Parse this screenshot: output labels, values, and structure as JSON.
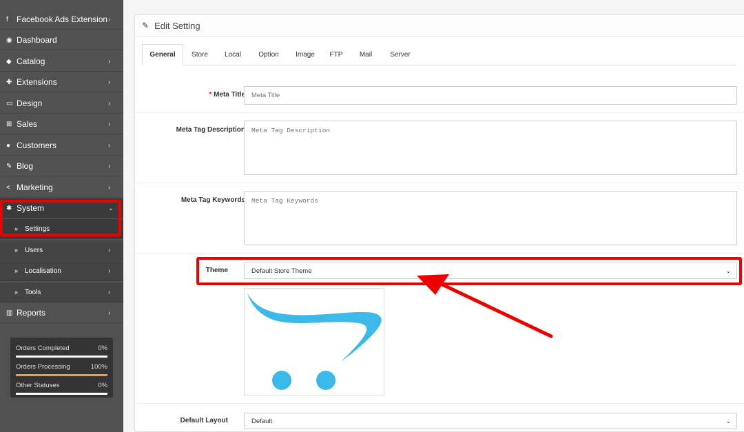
{
  "sidebar": {
    "items": [
      {
        "label": "Facebook Ads Extension",
        "icon": "facebook-icon",
        "chevron": "›"
      },
      {
        "label": "Dashboard",
        "icon": "dashboard-icon",
        "chevron": ""
      },
      {
        "label": "Catalog",
        "icon": "tag-icon",
        "chevron": "›"
      },
      {
        "label": "Extensions",
        "icon": "puzzle-icon",
        "chevron": "›"
      },
      {
        "label": "Design",
        "icon": "monitor-icon",
        "chevron": "›"
      },
      {
        "label": "Sales",
        "icon": "cart-icon",
        "chevron": "›"
      },
      {
        "label": "Customers",
        "icon": "user-icon",
        "chevron": "›"
      },
      {
        "label": "Blog",
        "icon": "edit-icon",
        "chevron": "›"
      },
      {
        "label": "Marketing",
        "icon": "share-icon",
        "chevron": "›"
      },
      {
        "label": "System",
        "icon": "gear-icon",
        "chevron": "⌄"
      }
    ],
    "subitems": [
      {
        "label": "Settings",
        "icon": "double-chevron-icon",
        "chevron": ""
      },
      {
        "label": "Users",
        "icon": "double-chevron-icon",
        "chevron": "›"
      },
      {
        "label": "Localisation",
        "icon": "double-chevron-icon",
        "chevron": "›"
      },
      {
        "label": "Tools",
        "icon": "double-chevron-icon",
        "chevron": "›"
      }
    ],
    "reports": {
      "label": "Reports",
      "icon": "bar-chart-icon",
      "chevron": "›"
    },
    "stats": [
      {
        "label": "Orders Completed",
        "value": "0%",
        "progress": 0
      },
      {
        "label": "Orders Processing",
        "value": "100%",
        "progress": 100
      },
      {
        "label": "Other Statuses",
        "value": "0%",
        "progress": 0
      }
    ]
  },
  "panel": {
    "title": "Edit Setting",
    "title_icon": "pencil-icon",
    "tabs": [
      "General",
      "Store",
      "Local",
      "Option",
      "Image",
      "FTP",
      "Mail",
      "Server"
    ],
    "active_tab": "General"
  },
  "form": {
    "meta_title": {
      "label": "Meta Title",
      "required": "*",
      "placeholder": "Meta Title",
      "value": ""
    },
    "meta_description": {
      "label": "Meta Tag Description",
      "placeholder": "Meta Tag Description",
      "value": ""
    },
    "meta_keywords": {
      "label": "Meta Tag Keywords",
      "placeholder": "Meta Tag Keywords",
      "value": ""
    },
    "theme": {
      "label": "Theme",
      "value": "Default Store Theme"
    },
    "default_layout": {
      "label": "Default Layout",
      "value": "Default"
    }
  },
  "colors": {
    "sidebar_bg": "#515151",
    "highlight": "#ee0000",
    "logo_blue": "#3cb9e8",
    "progress": "#f0a030"
  }
}
